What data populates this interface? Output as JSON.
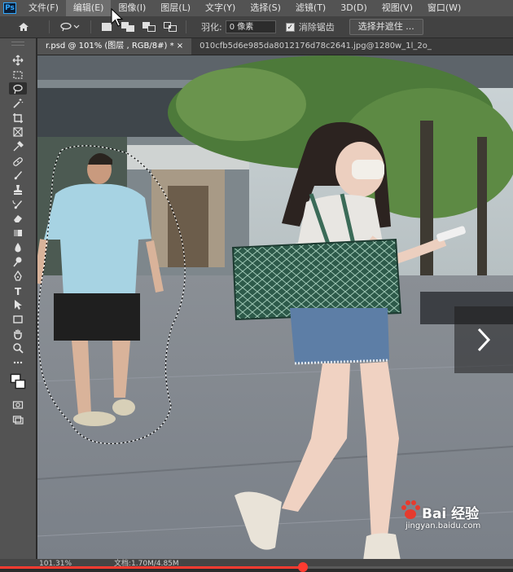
{
  "app": {
    "logo": "Ps"
  },
  "menu": {
    "items": [
      {
        "label": "文件(F)"
      },
      {
        "label": "编辑(E)",
        "active": true
      },
      {
        "label": "图像(I)"
      },
      {
        "label": "图层(L)"
      },
      {
        "label": "文字(Y)"
      },
      {
        "label": "选择(S)"
      },
      {
        "label": "滤镜(T)"
      },
      {
        "label": "3D(D)"
      },
      {
        "label": "视图(V)"
      },
      {
        "label": "窗口(W)"
      }
    ]
  },
  "options": {
    "feather_label": "羽化:",
    "feather_value": "0 像素",
    "antialias_label": "消除锯齿",
    "antialias_checked": true,
    "select_mask_label": "选择并遮住 ..."
  },
  "tabs": [
    {
      "label": "r.psd @ 101% (图层 , RGB/8#) *",
      "active": true
    },
    {
      "label": "010cfb5d6e985da8012176d78c2641.jpg@1280w_1l_2o_",
      "active": false
    }
  ],
  "tools": [
    {
      "name": "move-tool",
      "icon": "move-icon"
    },
    {
      "name": "marquee-tool",
      "icon": "marquee-icon"
    },
    {
      "name": "lasso-tool",
      "icon": "lasso-icon",
      "selected": true
    },
    {
      "name": "quick-select-tool",
      "icon": "magic-wand-icon"
    },
    {
      "name": "crop-tool",
      "icon": "crop-icon"
    },
    {
      "name": "frame-tool",
      "icon": "frame-icon"
    },
    {
      "name": "eyedropper-tool",
      "icon": "eyedropper-icon"
    },
    {
      "name": "healing-brush-tool",
      "icon": "bandage-icon"
    },
    {
      "name": "brush-tool",
      "icon": "brush-icon"
    },
    {
      "name": "clone-stamp-tool",
      "icon": "stamp-icon"
    },
    {
      "name": "history-brush-tool",
      "icon": "history-brush-icon"
    },
    {
      "name": "eraser-tool",
      "icon": "eraser-icon"
    },
    {
      "name": "gradient-tool",
      "icon": "gradient-icon"
    },
    {
      "name": "blur-tool",
      "icon": "drop-icon"
    },
    {
      "name": "dodge-tool",
      "icon": "dodge-icon"
    },
    {
      "name": "pen-tool",
      "icon": "pen-icon"
    },
    {
      "name": "type-tool",
      "icon": "type-icon",
      "glyph": "T"
    },
    {
      "name": "path-select-tool",
      "icon": "arrow-icon"
    },
    {
      "name": "rectangle-tool",
      "icon": "rectangle-icon"
    },
    {
      "name": "hand-tool",
      "icon": "hand-icon"
    },
    {
      "name": "zoom-tool",
      "icon": "magnifier-icon"
    },
    {
      "name": "more-tools",
      "icon": "ellipsis-icon"
    },
    {
      "name": "color-swatches",
      "icon": "swatches-icon"
    },
    {
      "name": "quick-mask",
      "icon": "quick-mask-icon"
    },
    {
      "name": "screen-mode",
      "icon": "screen-mode-icon"
    }
  ],
  "status": {
    "zoom": "101.31%",
    "doc_info": "文档:1.70M/4.85M",
    "progress": 0.59
  },
  "watermark": {
    "brand": "Bai 经验",
    "url": "jingyan.baidu.com"
  },
  "colors": {
    "accent": "#31a8ff",
    "progress": "#ff3b30",
    "panel": "#535353"
  }
}
